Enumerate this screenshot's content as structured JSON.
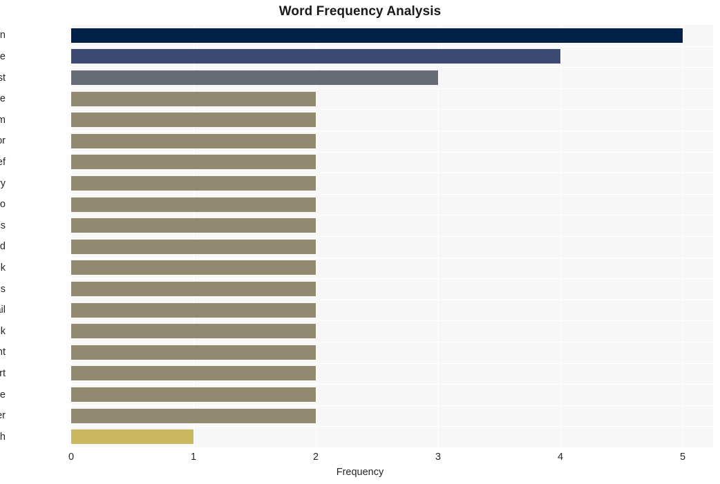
{
  "chart_data": {
    "type": "bar",
    "orientation": "horizontal",
    "title": "Word Frequency Analysis",
    "xlabel": "Frequency",
    "ylabel": "",
    "xlim": [
      0,
      5
    ],
    "xticks": [
      0,
      1,
      2,
      3,
      4,
      5
    ],
    "xtick_labels": [
      "0",
      "1",
      "2",
      "3",
      "4",
      "5"
    ],
    "grid": true,
    "grid_color": "#ffffff",
    "plot_background": "#f7f7f7",
    "figure_background": "#ffffff",
    "legend": null,
    "categories": [
      "sign",
      "name",
      "test",
      "sophie",
      "kihm",
      "editor",
      "chief",
      "nameberry",
      "ceo",
      "business",
      "read",
      "thank",
      "preferences",
      "email",
      "click",
      "parent",
      "start",
      "see",
      "insider",
      "hash"
    ],
    "values": [
      5,
      4,
      3,
      2,
      2,
      2,
      2,
      2,
      2,
      2,
      2,
      2,
      2,
      2,
      2,
      2,
      2,
      2,
      2,
      1
    ],
    "bar_colors": [
      "#002147",
      "#3a4a72",
      "#676b76",
      "#918a70",
      "#918a70",
      "#918a70",
      "#918a70",
      "#918a70",
      "#918a70",
      "#918a70",
      "#918a70",
      "#918a70",
      "#918a70",
      "#918a70",
      "#918a70",
      "#918a70",
      "#918a70",
      "#918a70",
      "#918a70",
      "#c9b860"
    ]
  }
}
